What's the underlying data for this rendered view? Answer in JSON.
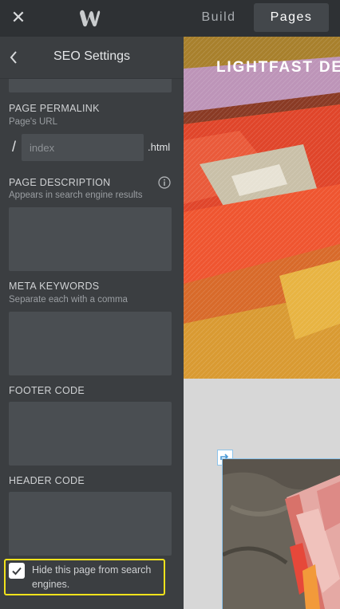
{
  "topbar": {
    "close_icon": "✕",
    "logo_name": "weebly-logo",
    "tabs": {
      "build": "Build",
      "pages": "Pages"
    }
  },
  "sidebar": {
    "title": "SEO Settings",
    "permalink": {
      "label": "PAGE PERMALINK",
      "sub": "Page's URL",
      "slash": "/",
      "placeholder": "index",
      "ext": ".html"
    },
    "description": {
      "label": "PAGE DESCRIPTION",
      "sub": "Appears in search engine results"
    },
    "keywords": {
      "label": "META KEYWORDS",
      "sub": "Separate each with a comma"
    },
    "footer_code": {
      "label": "FOOTER CODE"
    },
    "header_code": {
      "label": "HEADER CODE"
    },
    "hide": {
      "text": "Hide this page from search engines.",
      "checked": true,
      "highlight_color": "#f1e21c"
    }
  },
  "preview": {
    "hero_title": "LIGHTFAST DE",
    "selection_color": "#8cc4ec"
  }
}
